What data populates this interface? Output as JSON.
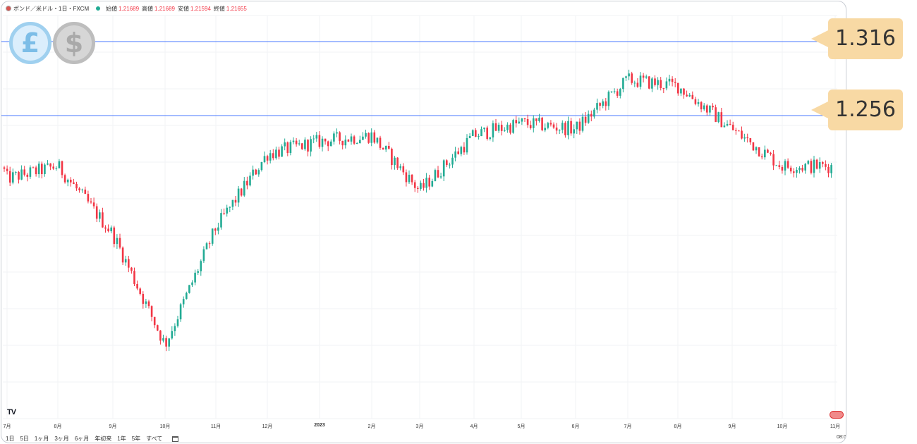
{
  "header": {
    "symbol": "ポンド／米ドル・1日・FXCM",
    "open_label": "始値",
    "open_value": "1.21689",
    "high_label": "高値",
    "high_value": "1.21689",
    "low_label": "安値",
    "low_value": "1.21594",
    "close_label": "終値",
    "close_value": "1.21655"
  },
  "price_tags": [
    "1.316",
    "1.256"
  ],
  "x_axis_labels": [
    "7月",
    "8月",
    "9月",
    "10月",
    "11月",
    "12月",
    "2023",
    "2月",
    "3月",
    "4月",
    "5月",
    "6月",
    "7月",
    "8月",
    "9月",
    "10月",
    "11月"
  ],
  "range_buttons": [
    "1日",
    "5日",
    "1ヶ月",
    "3ヶ月",
    "6ヶ月",
    "年初来",
    "1年",
    "5年",
    "すべて"
  ],
  "time_text": "08:0",
  "logo_text": "TV",
  "colors": {
    "up": "#22ab94",
    "down": "#f23645",
    "hline": "#2962ff",
    "tag": "#f8d9a4"
  },
  "icons": [
    "pound-coin-icon",
    "dollar-coin-icon",
    "calendar-icon",
    "flag-icon"
  ],
  "chart_data": {
    "type": "candlestick",
    "title": "",
    "x": [
      "7月",
      "8月",
      "9月",
      "10月",
      "11月",
      "12月",
      "2023",
      "2月",
      "3月",
      "4月",
      "5月",
      "6月",
      "7月",
      "8月",
      "9月",
      "10月",
      "11月"
    ],
    "close_path": [
      {
        "x": "7月",
        "y": 1.205
      },
      {
        "x": "8月",
        "y": 1.215
      },
      {
        "x": "9月",
        "y": 1.16
      },
      {
        "x": "10月",
        "y": 1.07
      },
      {
        "x": "11月",
        "y": 1.165
      },
      {
        "x": "12月",
        "y": 1.225
      },
      {
        "x": "2023",
        "y": 1.235
      },
      {
        "x": "2月",
        "y": 1.24
      },
      {
        "x": "3月",
        "y": 1.195
      },
      {
        "x": "4月",
        "y": 1.24
      },
      {
        "x": "5月",
        "y": 1.25
      },
      {
        "x": "6月",
        "y": 1.245
      },
      {
        "x": "7月",
        "y": 1.285
      },
      {
        "x": "8月",
        "y": 1.28
      },
      {
        "x": "9月",
        "y": 1.245
      },
      {
        "x": "10月",
        "y": 1.215
      },
      {
        "x": "11月",
        "y": 1.215
      }
    ],
    "horizontal_lines": [
      1.316,
      1.256
    ],
    "ylim": [
      1.035,
      1.325
    ]
  }
}
